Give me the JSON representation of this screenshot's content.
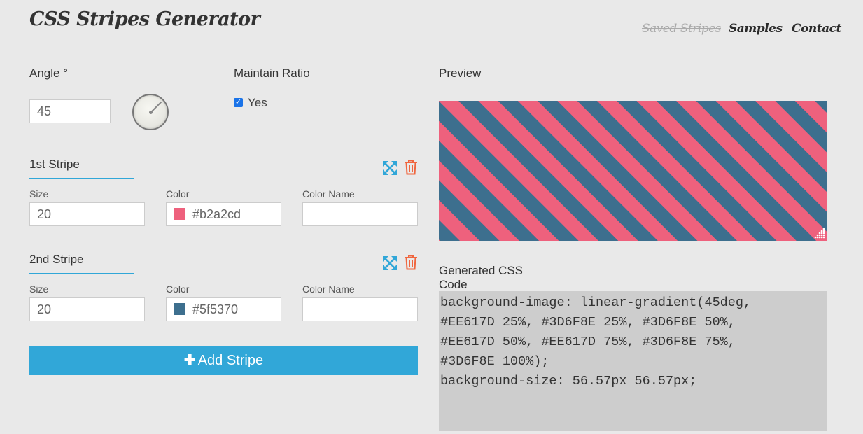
{
  "header": {
    "brand": "CSS Stripes Generator",
    "nav": {
      "saved": "Saved Stripes",
      "samples": "Samples",
      "contact": "Contact"
    }
  },
  "angle": {
    "label": "Angle °",
    "value": "45"
  },
  "ratio": {
    "label": "Maintain Ratio",
    "checked": true,
    "option_label": "Yes"
  },
  "stripes": [
    {
      "title": "1st Stripe",
      "size_label": "Size",
      "size": "20",
      "color_label": "Color",
      "color_value": "#b2a2cd",
      "swatch": "#EE617D",
      "name_label": "Color Name",
      "name_value": "",
      "icons": [
        "expand-icon",
        "trash-icon"
      ]
    },
    {
      "title": "2nd Stripe",
      "size_label": "Size",
      "size": "20",
      "color_label": "Color",
      "color_value": "#5f5370",
      "swatch": "#3D6F8E",
      "name_label": "Color Name",
      "name_value": "",
      "icons": [
        "expand-icon",
        "trash-icon"
      ]
    }
  ],
  "add_button": {
    "label": "Add Stripe",
    "icon": "plus-icon"
  },
  "preview": {
    "label": "Preview",
    "colors": [
      "#EE617D",
      "#3D6F8E"
    ]
  },
  "css_output": {
    "label": "Generated CSS Code",
    "code": "background-image: linear-gradient(45deg,\n#EE617D 25%, #3D6F8E 25%, #3D6F8E 50%,\n#EE617D 50%, #EE617D 75%, #3D6F8E 75%,\n#3D6F8E 100%);\nbackground-size: 56.57px 56.57px;"
  },
  "colors": {
    "accent": "#31a7d8",
    "danger": "#f0663f",
    "pink": "#EE617D",
    "blue": "#3D6F8E"
  }
}
